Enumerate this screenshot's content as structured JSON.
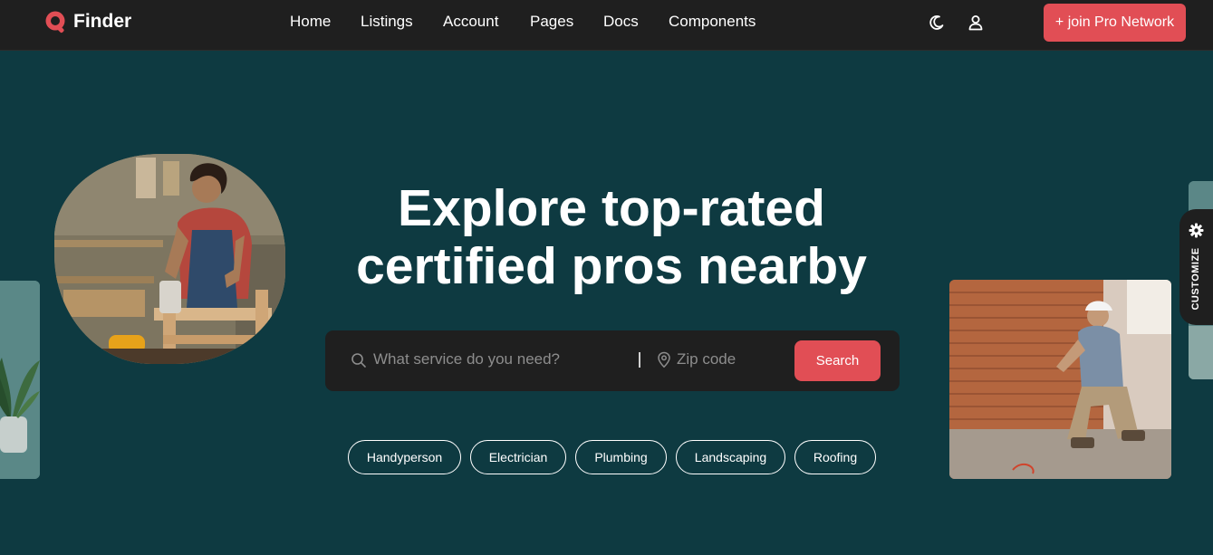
{
  "brand": {
    "name": "Finder",
    "accent_color": "#e14e55",
    "logo_icon": "search-icon"
  },
  "nav": {
    "links": [
      "Home",
      "Listings",
      "Account",
      "Pages",
      "Docs",
      "Components"
    ],
    "theme_toggle_icon": "moon-icon",
    "account_icon": "user-icon",
    "cta_label": "+ join Pro Network"
  },
  "hero": {
    "title_line1": "Explore top-rated",
    "title_line2": "certified pros nearby",
    "background_color": "#0e3a41"
  },
  "search": {
    "service_placeholder": "What service do you need?",
    "service_value": "",
    "zip_placeholder": "Zip code",
    "zip_value": "",
    "button_label": "Search"
  },
  "categories": [
    "Handyperson",
    "Electrician",
    "Plumbing",
    "Landscaping",
    "Roofing"
  ],
  "customize": {
    "label": "CUSTOMIZE",
    "icon": "gear-icon"
  }
}
